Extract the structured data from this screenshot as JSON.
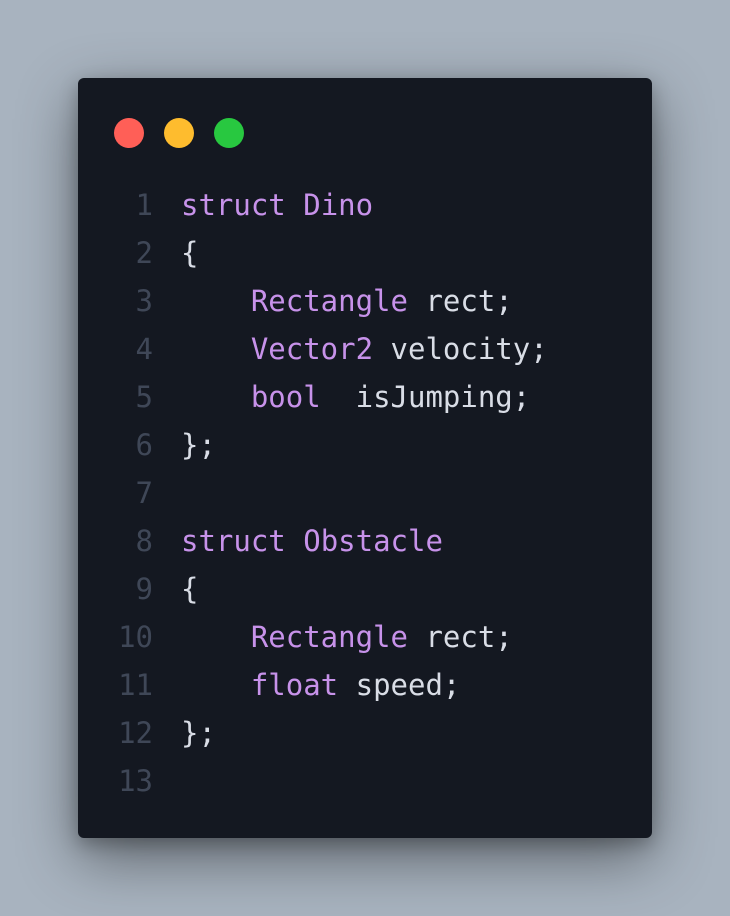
{
  "window": {
    "controls": [
      {
        "name": "close",
        "color": "#ff5f57"
      },
      {
        "name": "minimize",
        "color": "#febc2e"
      },
      {
        "name": "maximize",
        "color": "#28c840"
      }
    ]
  },
  "code": {
    "lines": [
      {
        "number": "1",
        "tokens": [
          {
            "text": "struct",
            "kind": "keyword"
          },
          {
            "text": " ",
            "kind": "space"
          },
          {
            "text": "Dino",
            "kind": "type"
          }
        ]
      },
      {
        "number": "2",
        "tokens": [
          {
            "text": "{",
            "kind": "punct"
          }
        ]
      },
      {
        "number": "3",
        "tokens": [
          {
            "text": "    ",
            "kind": "space"
          },
          {
            "text": "Rectangle",
            "kind": "type"
          },
          {
            "text": " ",
            "kind": "space"
          },
          {
            "text": "rect;",
            "kind": "ident"
          }
        ]
      },
      {
        "number": "4",
        "tokens": [
          {
            "text": "    ",
            "kind": "space"
          },
          {
            "text": "Vector2",
            "kind": "type"
          },
          {
            "text": " ",
            "kind": "space"
          },
          {
            "text": "velocity;",
            "kind": "ident"
          }
        ]
      },
      {
        "number": "5",
        "tokens": [
          {
            "text": "    ",
            "kind": "space"
          },
          {
            "text": "bool",
            "kind": "type"
          },
          {
            "text": "  ",
            "kind": "space"
          },
          {
            "text": "isJumping;",
            "kind": "ident"
          }
        ]
      },
      {
        "number": "6",
        "tokens": [
          {
            "text": "};",
            "kind": "punct"
          }
        ]
      },
      {
        "number": "7",
        "tokens": []
      },
      {
        "number": "8",
        "tokens": [
          {
            "text": "struct",
            "kind": "keyword"
          },
          {
            "text": " ",
            "kind": "space"
          },
          {
            "text": "Obstacle",
            "kind": "type"
          }
        ]
      },
      {
        "number": "9",
        "tokens": [
          {
            "text": "{",
            "kind": "punct"
          }
        ]
      },
      {
        "number": "10",
        "tokens": [
          {
            "text": "    ",
            "kind": "space"
          },
          {
            "text": "Rectangle",
            "kind": "type"
          },
          {
            "text": " ",
            "kind": "space"
          },
          {
            "text": "rect;",
            "kind": "ident"
          }
        ]
      },
      {
        "number": "11",
        "tokens": [
          {
            "text": "    ",
            "kind": "space"
          },
          {
            "text": "float",
            "kind": "type"
          },
          {
            "text": " ",
            "kind": "space"
          },
          {
            "text": "speed;",
            "kind": "ident"
          }
        ]
      },
      {
        "number": "12",
        "tokens": [
          {
            "text": "};",
            "kind": "punct"
          }
        ]
      },
      {
        "number": "13",
        "tokens": []
      }
    ]
  }
}
